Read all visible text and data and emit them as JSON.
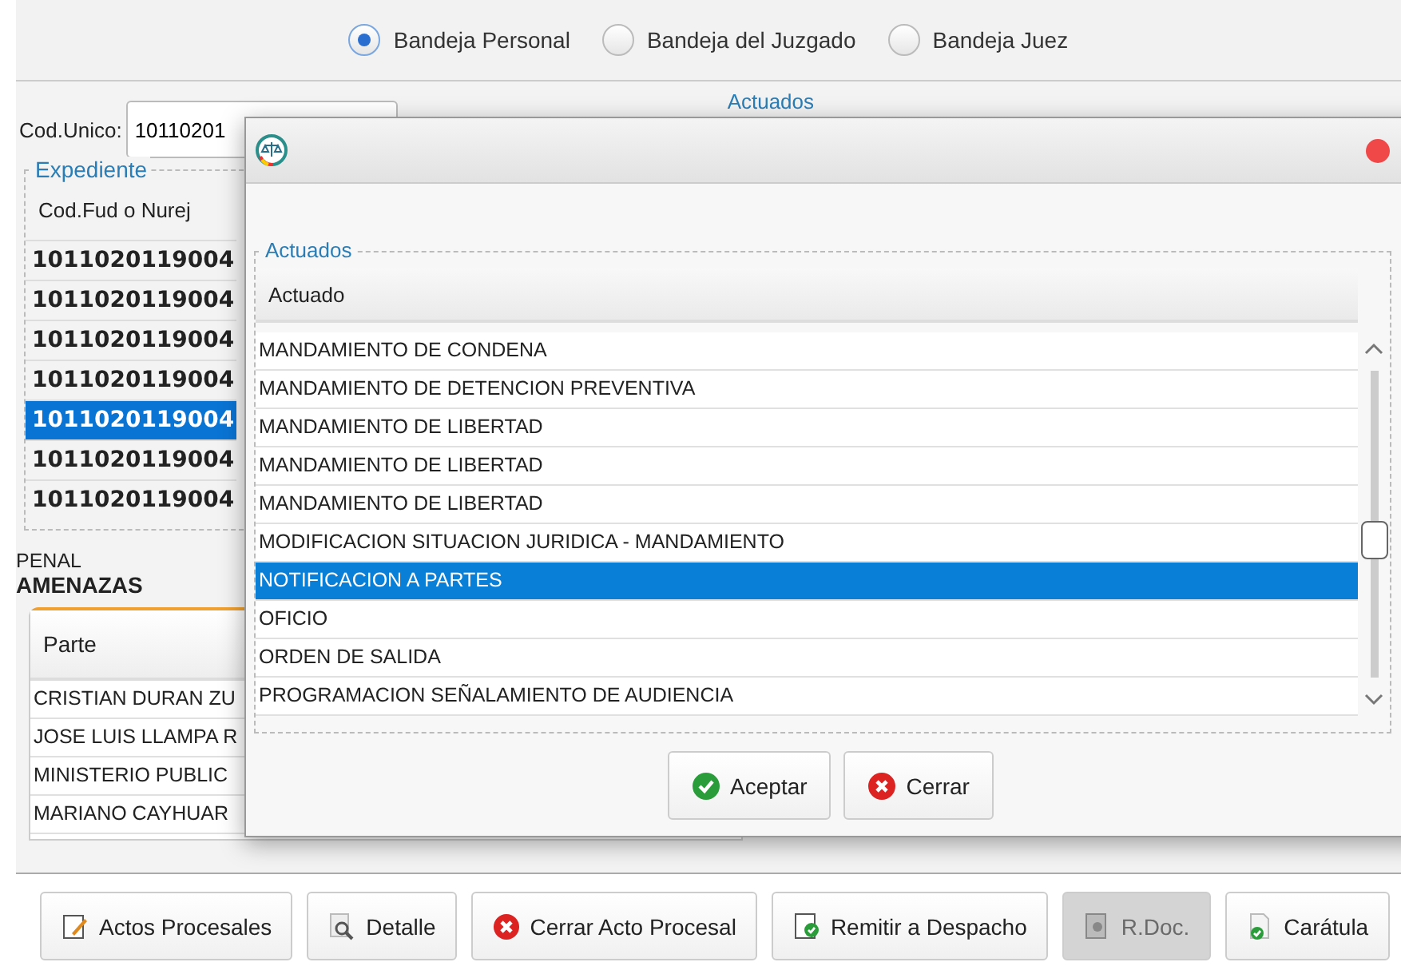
{
  "radios": [
    {
      "label": "Bandeja Personal",
      "selected": true
    },
    {
      "label": "Bandeja del Juzgado",
      "selected": false
    },
    {
      "label": "Bandeja Juez",
      "selected": false
    }
  ],
  "cod_unico": {
    "label": "Cod.Unico:",
    "value": "10110201"
  },
  "actuados_group": {
    "legend": "Actuados"
  },
  "expediente": {
    "legend": "Expediente",
    "column": "Cod.Fud o Nurej",
    "rows": [
      {
        "code": "1011020119004",
        "selected": false
      },
      {
        "code": "1011020119004",
        "selected": false
      },
      {
        "code": "1011020119004",
        "selected": false
      },
      {
        "code": "1011020119004",
        "selected": false
      },
      {
        "code": "1011020119004",
        "selected": true
      },
      {
        "code": "1011020119004",
        "selected": false
      },
      {
        "code": "1011020119004",
        "selected": false
      }
    ]
  },
  "materia": "PENAL",
  "delito": "AMENAZAS",
  "partes": {
    "column": "Parte",
    "rows": [
      "CRISTIAN DURAN ZU",
      "JOSE LUIS LLAMPA R",
      "MINISTERIO PUBLIC",
      "MARIANO CAYHUAR"
    ]
  },
  "dialog": {
    "legend": "Actuados",
    "column": "Actuado",
    "rows": [
      {
        "text": "MANDAMIENTO DE CONDENA",
        "selected": false
      },
      {
        "text": "MANDAMIENTO DE DETENCION PREVENTIVA",
        "selected": false
      },
      {
        "text": "MANDAMIENTO DE LIBERTAD",
        "selected": false
      },
      {
        "text": "MANDAMIENTO DE LIBERTAD",
        "selected": false
      },
      {
        "text": "MANDAMIENTO DE LIBERTAD",
        "selected": false
      },
      {
        "text": "MODIFICACION SITUACION JURIDICA - MANDAMIENTO",
        "selected": false
      },
      {
        "text": "NOTIFICACION A PARTES",
        "selected": true
      },
      {
        "text": "OFICIO",
        "selected": false
      },
      {
        "text": "ORDEN DE SALIDA",
        "selected": false
      },
      {
        "text": "PROGRAMACION SEÑALAMIENTO DE AUDIENCIA",
        "selected": false
      }
    ],
    "buttons": [
      {
        "label": "Aceptar",
        "kind": "accept"
      },
      {
        "label": "Cerrar",
        "kind": "close"
      }
    ]
  },
  "toolbar": [
    {
      "label": "Actos Procesales",
      "kind": "edit",
      "disabled": false
    },
    {
      "label": "Detalle",
      "kind": "search",
      "disabled": false
    },
    {
      "label": "Cerrar Acto Procesal",
      "kind": "close",
      "disabled": false
    },
    {
      "label": "Remitir a Despacho",
      "kind": "send",
      "disabled": false
    },
    {
      "label": "R.Doc.",
      "kind": "doc",
      "disabled": true
    },
    {
      "label": "Carátula",
      "kind": "cover",
      "disabled": false
    }
  ]
}
